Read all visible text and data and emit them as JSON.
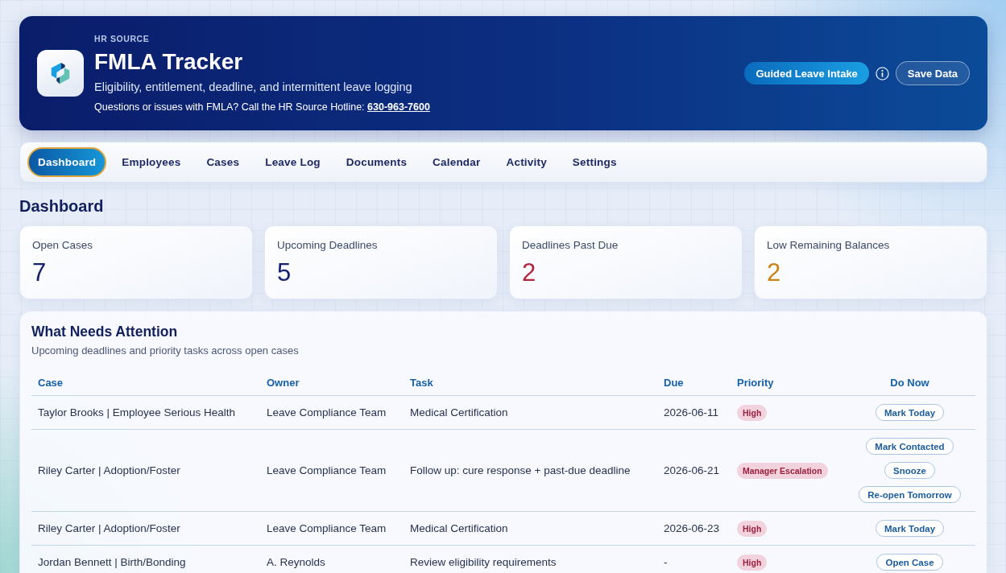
{
  "header": {
    "eyebrow": "HR SOURCE",
    "title": "FMLA Tracker",
    "subtitle": "Eligibility, entitlement, deadline, and intermittent leave logging",
    "hotline_text": "Questions or issues with FMLA? Call the HR Source Hotline:",
    "hotline_number": "630-963-7600",
    "actions": [
      {
        "kind": "primary",
        "label": "Guided Leave Intake"
      },
      {
        "kind": "info"
      },
      {
        "kind": "outline",
        "label": "Save Data"
      }
    ]
  },
  "tabs": [
    {
      "label": "Dashboard",
      "selected": true
    },
    {
      "label": "Employees",
      "selected": false
    },
    {
      "label": "Cases",
      "selected": false
    },
    {
      "label": "Leave Log",
      "selected": false
    },
    {
      "label": "Documents",
      "selected": false
    },
    {
      "label": "Calendar",
      "selected": false
    },
    {
      "label": "Activity",
      "selected": false
    },
    {
      "label": "Settings",
      "selected": false
    }
  ],
  "page_title": "Dashboard",
  "stats": [
    {
      "label": "Open Cases",
      "value": "7",
      "color": "#16206e"
    },
    {
      "label": "Upcoming Deadlines",
      "value": "5",
      "color": "#16206e"
    },
    {
      "label": "Deadlines Past Due",
      "value": "2",
      "color": "#b3263f"
    },
    {
      "label": "Low Remaining Balances",
      "value": "2",
      "color": "#c98416"
    }
  ],
  "attention": {
    "title": "What Needs Attention",
    "subtitle": "Upcoming deadlines and priority tasks across open cases",
    "table": {
      "columns": [
        "Case",
        "Owner",
        "Task",
        "Due",
        "Priority",
        "Do Now"
      ],
      "rows": [
        {
          "case": "Taylor Brooks | Employee Serious Health",
          "owner": "Leave Compliance Team",
          "task": "Medical Certification",
          "due": "2026-06-11",
          "priority": "High",
          "actions": [
            "Mark Today"
          ]
        },
        {
          "case": "Riley Carter | Adoption/Foster",
          "owner": "Leave Compliance Team",
          "task": "Follow up: cure response + past-due deadline",
          "due": "2026-06-21",
          "priority": "Manager Escalation",
          "actions": [
            "Mark Contacted",
            "Snooze",
            "Re-open Tomorrow"
          ]
        },
        {
          "case": "Riley Carter | Adoption/Foster",
          "owner": "Leave Compliance Team",
          "task": "Medical Certification",
          "due": "2026-06-23",
          "priority": "High",
          "actions": [
            "Mark Today"
          ]
        },
        {
          "case": "Jordan Bennett | Birth/Bonding",
          "owner": "A. Reynolds",
          "task": "Review eligibility requirements",
          "due": "-",
          "priority": "High",
          "actions": [
            "Open Case"
          ]
        }
      ]
    }
  }
}
